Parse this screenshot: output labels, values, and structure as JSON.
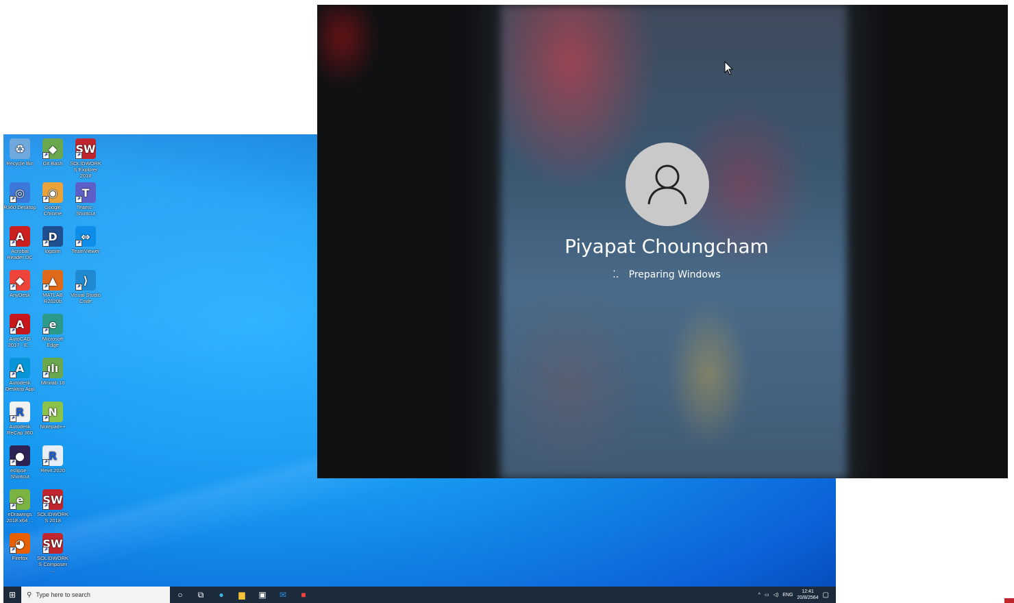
{
  "desktop": {
    "icons": [
      {
        "label": "Recycle Bin",
        "icon": "recycle-bin-icon",
        "color": "#6fa8dc",
        "glyph": "♻"
      },
      {
        "label": "Git Bash",
        "icon": "git-bash-icon",
        "color": "#6aa84f",
        "glyph": "◆"
      },
      {
        "label": "SOLIDWORKS Explorer 2018",
        "icon": "solidworks-explorer-icon",
        "color": "#c0262d",
        "glyph": "SW"
      },
      {
        "label": "R360 Desktop",
        "icon": "r360-desktop-icon",
        "color": "#3c78d8",
        "glyph": "◎"
      },
      {
        "label": "Google Chrome",
        "icon": "chrome-icon",
        "color": "#e8a33a",
        "glyph": "◉"
      },
      {
        "label": "Teams - Shortcut",
        "icon": "teams-icon",
        "color": "#5b5fc7",
        "glyph": "T"
      },
      {
        "label": "Acrobat Reader DC",
        "icon": "acrobat-icon",
        "color": "#cc1f1f",
        "glyph": "A"
      },
      {
        "label": "logisim",
        "icon": "logisim-icon",
        "color": "#1d4f91",
        "glyph": "D"
      },
      {
        "label": "TeamViewer",
        "icon": "teamviewer-icon",
        "color": "#0e8ee9",
        "glyph": "⇔"
      },
      {
        "label": "AnyDesk",
        "icon": "anydesk-icon",
        "color": "#ef443b",
        "glyph": "◆"
      },
      {
        "label": "MATLAB R2020b",
        "icon": "matlab-icon",
        "color": "#e06a1b",
        "glyph": "▲"
      },
      {
        "label": "Visual Studio Code",
        "icon": "vscode-icon",
        "color": "#1f8ad2",
        "glyph": "⟩"
      },
      {
        "label": "AutoCAD 2017 - E...",
        "icon": "autocad-icon",
        "color": "#c7171c",
        "glyph": "A"
      },
      {
        "label": "Microsoft Edge",
        "icon": "edge-icon",
        "color": "#2b9a8a",
        "glyph": "e"
      },
      {
        "label": "Autodesk Desktop App",
        "icon": "autodesk-desktop-icon",
        "color": "#0696d7",
        "glyph": "A"
      },
      {
        "label": "Minitab 18",
        "icon": "minitab-icon",
        "color": "#6aa84f",
        "glyph": "ılı"
      },
      {
        "label": "Autodesk ReCap 360",
        "icon": "recap-icon",
        "color": "#f2f2f2",
        "glyph": "R"
      },
      {
        "label": "Notepad++",
        "icon": "notepadpp-icon",
        "color": "#8bc34a",
        "glyph": "N"
      },
      {
        "label": "eclipse - Shortcut",
        "icon": "eclipse-icon",
        "color": "#2c2255",
        "glyph": "●"
      },
      {
        "label": "Revit 2020",
        "icon": "revit-icon",
        "color": "#e8eef7",
        "glyph": "R"
      },
      {
        "label": "eDrawings 2018 x64 ...",
        "icon": "edrawings-icon",
        "color": "#7bb342",
        "glyph": "e"
      },
      {
        "label": "SOLIDWORKS 2018",
        "icon": "solidworks-icon",
        "color": "#c0262d",
        "glyph": "SW"
      },
      {
        "label": "Firefox",
        "icon": "firefox-icon",
        "color": "#e66000",
        "glyph": "◕"
      },
      {
        "label": "SOLIDWORKS Composer ...",
        "icon": "solidworks-composer-icon",
        "color": "#c0262d",
        "glyph": "SW"
      }
    ],
    "taskbar": {
      "search_placeholder": "Type here to search",
      "tray_lang": "ENG",
      "time": "12:41",
      "date": "20/8/2564"
    }
  },
  "login": {
    "user_name": "Piyapat Choungcham",
    "status": "Preparing Windows"
  }
}
